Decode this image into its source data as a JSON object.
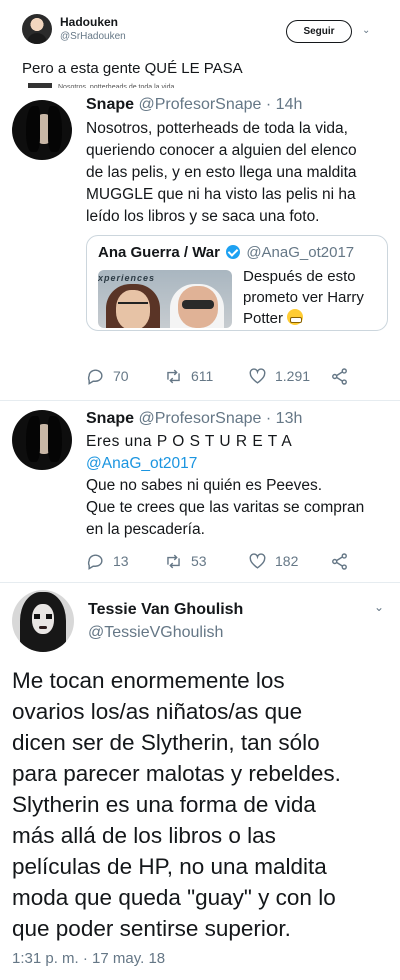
{
  "top_tweet": {
    "name": "Hadouken",
    "handle": "@SrHadouken",
    "follow_label": "Seguir",
    "menu_chevron": "chevron-down-icon",
    "text": "Pero a esta gente QUÉ LE PASA",
    "cut_text": "Nosotros, potterheads de toda la vida"
  },
  "tweet1": {
    "name": "Snape",
    "handle": "@ProfesorSnape",
    "time": "· 14h",
    "lines": [
      "Nosotros, potterheads de toda la vida,",
      "queriendo conocer a alguien del elenco",
      "de las pelis, y en esto llega una maldita",
      "MUGGLE que ni ha visto las pelis ni ha",
      "leído los libros y se saca una foto."
    ],
    "quote": {
      "name": "Ana Guerra / War",
      "handle": "@AnaG_ot2017",
      "image_banner": "xperiences",
      "text_lines": [
        "Después de esto",
        "prometo ver Harry",
        "Potter"
      ]
    },
    "replies": "70",
    "retweets": "611",
    "likes": "1.291"
  },
  "tweet2": {
    "name": "Snape",
    "handle": "@ProfesorSnape",
    "time": "· 13h",
    "line1": "Eres una P O S T U R E T A",
    "mention": "@AnaG_ot2017",
    "line3": "Que no sabes ni quién es Peeves.",
    "line4": "Que te crees que las varitas se compran",
    "line5": "en la pescadería.",
    "replies": "13",
    "retweets": "53",
    "likes": "182"
  },
  "tweet3": {
    "name": "Tessie Van Ghoulish",
    "handle": "@TessieVGhoulish",
    "lines": [
      "Me tocan enormemente los",
      "ovarios los/as niñatos/as que",
      "dicen ser de Slytherin, tan sólo",
      "para parecer malotas y rebeldes.",
      "Slytherin es una forma de vida",
      "más allá de los libros o las",
      "películas de HP, no una maldita",
      "moda que queda \"guay\" y con lo",
      "que poder sentirse superior."
    ],
    "date": "1:31 p. m. · 17 may. 18"
  },
  "colors": {
    "link": "#1b95e0",
    "secondary_text": "#657786",
    "divider": "#e6ecf0",
    "verified": "#1da1f2"
  }
}
